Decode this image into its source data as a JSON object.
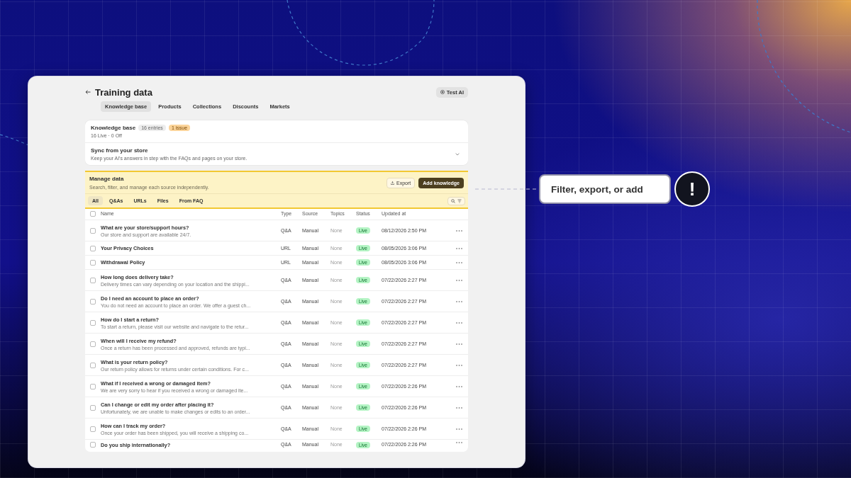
{
  "page": {
    "title": "Training data",
    "test_button": "Test AI"
  },
  "tabs": [
    {
      "label": "Knowledge base",
      "selected": true
    },
    {
      "label": "Products",
      "selected": false
    },
    {
      "label": "Collections",
      "selected": false
    },
    {
      "label": "Discounts",
      "selected": false
    },
    {
      "label": "Markets",
      "selected": false
    }
  ],
  "knowledge_card": {
    "title": "Knowledge base",
    "entries": "16 entries",
    "issues": "1 issue",
    "summary": "16 Live · 0 Off"
  },
  "sync": {
    "title": "Sync from your store",
    "description": "Keep your AI's answers in step with the FAQs and pages on your store.",
    "expanded": false
  },
  "manage": {
    "title": "Manage data",
    "description": "Search, filter, and manage each source independently.",
    "export_button": "Export",
    "add_button": "Add knowledge",
    "highlighted": true
  },
  "filters": [
    {
      "label": "All",
      "selected": true
    },
    {
      "label": "Q&As",
      "selected": false
    },
    {
      "label": "URLs",
      "selected": false
    },
    {
      "label": "Files",
      "selected": false
    },
    {
      "label": "From FAQ",
      "selected": false
    }
  ],
  "table": {
    "all_checked": false,
    "columns": [
      "Name",
      "Type",
      "Source",
      "Topics",
      "Status",
      "Updated at"
    ],
    "rows": [
      {
        "checked": false,
        "name": "What are your store/support hours?",
        "preview": "Our store and support are available 24/7.",
        "type": "Q&A",
        "source": "Manual",
        "topics": "None",
        "status": "Live",
        "updated": "08/12/2026 2:50 PM"
      },
      {
        "checked": false,
        "name": "Your Privacy Choices",
        "type": "URL",
        "source": "Manual",
        "topics": "None",
        "status": "Live",
        "updated": "08/05/2026 3:06 PM"
      },
      {
        "checked": false,
        "name": "Withdrawal Policy",
        "type": "URL",
        "source": "Manual",
        "topics": "None",
        "status": "Live",
        "updated": "08/05/2026 3:06 PM"
      },
      {
        "checked": false,
        "name": "How long does delivery take?",
        "preview": "Delivery times can vary depending on your location and the shippi...",
        "type": "Q&A",
        "source": "Manual",
        "topics": "None",
        "status": "Live",
        "updated": "07/22/2026 2:27 PM"
      },
      {
        "checked": false,
        "name": "Do I need an account to place an order?",
        "preview": "You do not need an account to place an order. We offer a guest ch...",
        "type": "Q&A",
        "source": "Manual",
        "topics": "None",
        "status": "Live",
        "updated": "07/22/2026 2:27 PM"
      },
      {
        "checked": false,
        "name": "How do I start a return?",
        "preview": "To start a return, please visit our website and navigate to the retur...",
        "type": "Q&A",
        "source": "Manual",
        "topics": "None",
        "status": "Live",
        "updated": "07/22/2026 2:27 PM"
      },
      {
        "checked": false,
        "name": "When will I receive my refund?",
        "preview": "Once a return has been processed and approved, refunds are typi...",
        "type": "Q&A",
        "source": "Manual",
        "topics": "None",
        "status": "Live",
        "updated": "07/22/2026 2:27 PM"
      },
      {
        "checked": false,
        "name": "What is your return policy?",
        "preview": "Our return policy allows for returns under certain conditions. For c...",
        "type": "Q&A",
        "source": "Manual",
        "topics": "None",
        "status": "Live",
        "updated": "07/22/2026 2:27 PM"
      },
      {
        "checked": false,
        "name": "What if I received a wrong or damaged item?",
        "preview": "We are very sorry to hear if you received a wrong or damaged ite...",
        "type": "Q&A",
        "source": "Manual",
        "topics": "None",
        "status": "Live",
        "updated": "07/22/2026 2:26 PM"
      },
      {
        "checked": false,
        "name": "Can I change or edit my order after placing it?",
        "preview": "Unfortunately, we are unable to make changes or edits to an order...",
        "type": "Q&A",
        "source": "Manual",
        "topics": "None",
        "status": "Live",
        "updated": "07/22/2026 2:26 PM"
      },
      {
        "checked": false,
        "name": "How can I track my order?",
        "preview": "Once your order has been shipped, you will receive a shipping co...",
        "type": "Q&A",
        "source": "Manual",
        "topics": "None",
        "status": "Live",
        "updated": "07/22/2026 2:26 PM"
      },
      {
        "checked": false,
        "name": "Do you ship internationally?",
        "type": "Q&A",
        "source": "Manual",
        "topics": "None",
        "status": "Live",
        "updated": "07/22/2026 2:26 PM"
      }
    ]
  },
  "callout": {
    "text": "Filter, export, or add",
    "badge": "!"
  }
}
